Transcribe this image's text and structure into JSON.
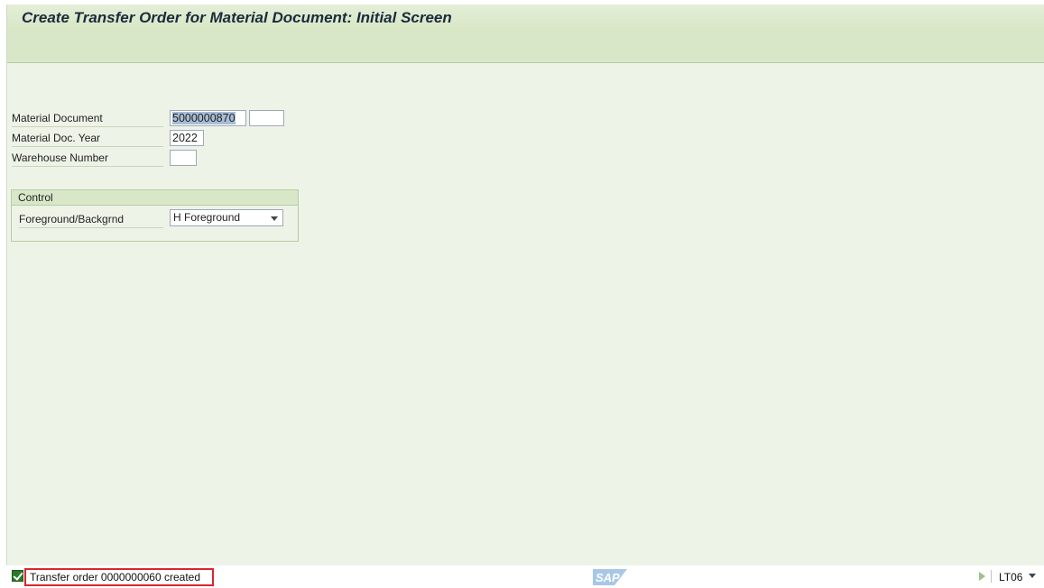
{
  "window": {
    "title": "Create Transfer Order for Material Document: Initial Screen"
  },
  "form": {
    "material_document": {
      "label": "Material Document",
      "value": "5000000870",
      "item_value": ""
    },
    "material_doc_year": {
      "label": "Material Doc. Year",
      "value": "2022"
    },
    "warehouse_number": {
      "label": "Warehouse Number",
      "value": ""
    }
  },
  "control": {
    "title": "Control",
    "foreground_label": "Foreground/Backgrnd",
    "foreground_value": "H Foreground"
  },
  "status": {
    "message": "Transfer order 0000000060 created",
    "type": "success",
    "transaction": "LT06",
    "logo_text": "SAP",
    "colors": {
      "success": "#2b7a2b",
      "highlight_border": "#d9262c",
      "logo": "#7aa7d6"
    }
  }
}
